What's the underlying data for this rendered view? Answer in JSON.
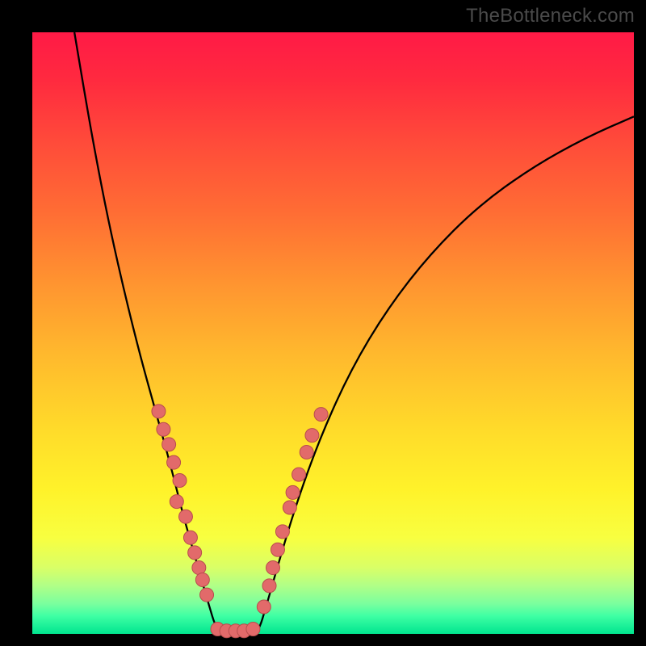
{
  "watermark": "TheBottleneck.com",
  "chart_data": {
    "type": "line",
    "title": "",
    "xlabel": "",
    "ylabel": "",
    "xlim": [
      0,
      100
    ],
    "ylim": [
      0,
      100
    ],
    "series": [
      {
        "name": "left-branch",
        "x": [
          7,
          9,
          11,
          13,
          15.5,
          18,
          20.5,
          23,
          25,
          27,
          29,
          30.8
        ],
        "y": [
          100,
          88,
          77,
          67,
          56,
          46,
          37,
          28,
          20,
          13,
          6,
          0
        ]
      },
      {
        "name": "valley-floor",
        "x": [
          30.8,
          33,
          35.5,
          37.5
        ],
        "y": [
          0,
          0,
          0,
          0
        ]
      },
      {
        "name": "right-branch",
        "x": [
          37.5,
          39,
          41,
          44,
          48,
          53,
          59,
          66,
          74,
          83,
          92,
          100
        ],
        "y": [
          0,
          5,
          12,
          22,
          33,
          44,
          54,
          63,
          71,
          77.5,
          82.5,
          86
        ]
      }
    ],
    "points": [
      {
        "name": "cluster-left",
        "coords": [
          [
            21.0,
            37.0
          ],
          [
            22.7,
            31.5
          ],
          [
            21.8,
            34.0
          ],
          [
            23.5,
            28.5
          ],
          [
            24.5,
            25.5
          ],
          [
            24.0,
            22.0
          ],
          [
            25.5,
            19.5
          ],
          [
            26.3,
            16.0
          ],
          [
            27.0,
            13.5
          ],
          [
            27.7,
            11.0
          ],
          [
            28.3,
            9.0
          ],
          [
            29.0,
            6.5
          ]
        ]
      },
      {
        "name": "cluster-bottom",
        "coords": [
          [
            30.8,
            0.8
          ],
          [
            32.3,
            0.5
          ],
          [
            33.8,
            0.5
          ],
          [
            35.2,
            0.5
          ],
          [
            36.7,
            0.8
          ]
        ]
      },
      {
        "name": "cluster-right",
        "coords": [
          [
            38.5,
            4.5
          ],
          [
            39.4,
            8.0
          ],
          [
            40.0,
            11.0
          ],
          [
            40.8,
            14.0
          ],
          [
            41.6,
            17.0
          ],
          [
            42.8,
            21.0
          ],
          [
            43.3,
            23.5
          ],
          [
            44.3,
            26.5
          ],
          [
            45.6,
            30.2
          ],
          [
            46.5,
            33.0
          ],
          [
            48.0,
            36.5
          ]
        ]
      }
    ],
    "gradient_stops": [
      {
        "pos": 0,
        "color": "#ff1a46"
      },
      {
        "pos": 100,
        "color": "#00e58f"
      }
    ]
  }
}
